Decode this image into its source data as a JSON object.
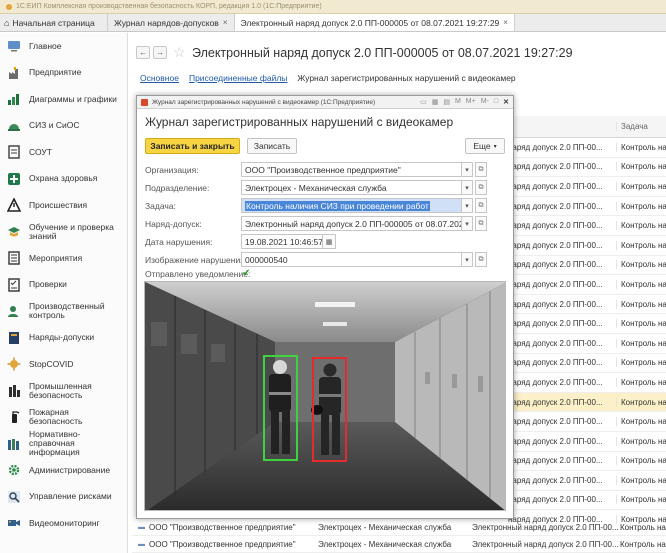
{
  "window_title": "1С:ЕИП Комплексная производственная безопасность КОРП, редакция 1.0  (1С:Предприятие)",
  "tabs": {
    "home": "Начальная страница",
    "items": [
      {
        "label": "Журнал нарядов-допусков",
        "active": false
      },
      {
        "label": "Электронный наряд допуск 2.0 ПП-000005 от 08.07.2021 19:27:29",
        "active": true
      }
    ]
  },
  "sidebar": {
    "items": [
      {
        "label": "Главное",
        "icon": "home-icon"
      },
      {
        "label": "Предприятие",
        "icon": "factory-icon"
      },
      {
        "label": "Диаграммы и графики",
        "icon": "chart-icon"
      },
      {
        "label": "СИЗ и СиОС",
        "icon": "helmet-icon"
      },
      {
        "label": "СОУТ",
        "icon": "document-icon"
      },
      {
        "label": "Охрана здоровья",
        "icon": "health-icon"
      },
      {
        "label": "Происшествия",
        "icon": "warning-icon"
      },
      {
        "label": "Обучение и проверка знаний",
        "icon": "education-icon"
      },
      {
        "label": "Мероприятия",
        "icon": "list-icon"
      },
      {
        "label": "Проверки",
        "icon": "checklist-icon"
      },
      {
        "label": "Производственный контроль",
        "icon": "inspector-icon"
      },
      {
        "label": "Наряды-допуски",
        "icon": "permit-icon"
      },
      {
        "label": "StopCOVID",
        "icon": "virus-icon"
      },
      {
        "label": "Промышленная безопасность",
        "icon": "industrial-icon"
      },
      {
        "label": "Пожарная безопасность",
        "icon": "extinguisher-icon"
      },
      {
        "label": "Нормативно-справочная информация",
        "icon": "books-icon"
      },
      {
        "label": "Администрирование",
        "icon": "gear-icon"
      },
      {
        "label": "Управление рисками",
        "icon": "risk-icon"
      },
      {
        "label": "Видеомониторинг",
        "icon": "camera-icon"
      }
    ]
  },
  "document": {
    "title": "Электронный наряд допуск 2.0 ПП-000005 от 08.07.2021 19:27:29",
    "links": [
      "Основное",
      "Присоединенные файлы"
    ],
    "current_section": "Журнал зарегистрированных нарушений с видеокамер"
  },
  "background_list": {
    "columns": [
      "к",
      "Задача"
    ],
    "rows": [
      {
        "c1": "наряд допуск 2.0 ПП-00...",
        "c2": "Контроль на",
        "hl": false
      },
      {
        "c1": "наряд допуск 2.0 ПП-00...",
        "c2": "Контроль на",
        "hl": false
      },
      {
        "c1": "наряд допуск 2.0 ПП-00...",
        "c2": "Контроль на",
        "hl": false
      },
      {
        "c1": "наряд допуск 2.0 ПП-00...",
        "c2": "Контроль на",
        "hl": false
      },
      {
        "c1": "наряд допуск 2.0 ПП-00...",
        "c2": "Контроль на",
        "hl": false
      },
      {
        "c1": "наряд допуск 2.0 ПП-00...",
        "c2": "Контроль на",
        "hl": false
      },
      {
        "c1": "наряд допуск 2.0 ПП-00...",
        "c2": "Контроль на",
        "hl": false
      },
      {
        "c1": "наряд допуск 2.0 ПП-00...",
        "c2": "Контроль на",
        "hl": false
      },
      {
        "c1": "наряд допуск 2.0 ПП-00...",
        "c2": "Контроль на",
        "hl": false
      },
      {
        "c1": "наряд допуск 2.0 ПП-00...",
        "c2": "Контроль на",
        "hl": false
      },
      {
        "c1": "наряд допуск 2.0 ПП-00...",
        "c2": "Контроль на",
        "hl": false
      },
      {
        "c1": "наряд допуск 2.0 ПП-00...",
        "c2": "Контроль на",
        "hl": false
      },
      {
        "c1": "наряд допуск 2.0 ПП-00...",
        "c2": "Контроль на",
        "hl": false
      },
      {
        "c1": "наряд допуск 2.0 ПП-00...",
        "c2": "Контроль на",
        "hl": true
      },
      {
        "c1": "наряд допуск 2.0 ПП-00...",
        "c2": "Контроль на",
        "hl": false
      },
      {
        "c1": "наряд допуск 2.0 ПП-00...",
        "c2": "Контроль на",
        "hl": false
      },
      {
        "c1": "наряд допуск 2.0 ПП-00...",
        "c2": "Контроль на",
        "hl": false
      },
      {
        "c1": "наряд допуск 2.0 ПП-00...",
        "c2": "Контроль на",
        "hl": false
      },
      {
        "c1": "наряд допуск 2.0 ПП-00...",
        "c2": "Контроль на",
        "hl": false
      },
      {
        "c1": "наряд допуск 2.0 ПП-00...",
        "c2": "Контроль на",
        "hl": false
      }
    ]
  },
  "bottom_rows": [
    {
      "org": "ООО \"Производственное предприятие\"",
      "dept": "Электроцех - Механическая служба",
      "doc": "Электронный наряд допуск 2.0 ПП-00...",
      "task": "Контроль на"
    },
    {
      "org": "ООО \"Производственное предприятие\"",
      "dept": "Электроцех - Механическая служба",
      "doc": "Электронный наряд допуск 2.0 ПП-00...",
      "task": "Контроль на"
    }
  ],
  "modal": {
    "window_title": "Журнал зарегистрированных нарушений с видеокамер  (1С:Предприятие)",
    "title": "Журнал зарегистрированных нарушений с видеокамер",
    "save_close": "Записать и закрыть",
    "save": "Записать",
    "more": "Еще",
    "fields": {
      "org_label": "Организация:",
      "org_value": "ООО \"Производственное предприятие\"",
      "dept_label": "Подразделение:",
      "dept_value": "Электроцех - Механическая служба",
      "task_label": "Задача:",
      "task_value": "Контроль наличия СИЗ при проведении работ",
      "permit_label": "Наряд-допуск:",
      "permit_value": "Электронный наряд допуск 2.0 ПП-000005 от 08.07.2021 19:",
      "date_label": "Дата нарушения:",
      "date_value": "19.08.2021 10:46:57",
      "image_label": "Изображение нарушения:",
      "image_value": "000000540",
      "notify_label": "Отправлено уведомление:",
      "notify_checked": true
    }
  },
  "colors": {
    "primary_button": "#f7d444",
    "link": "#1e5aa8",
    "highlight_row": "#fbf0c8",
    "box_ok": "#3fd23f",
    "box_violation": "#e52b2b"
  }
}
